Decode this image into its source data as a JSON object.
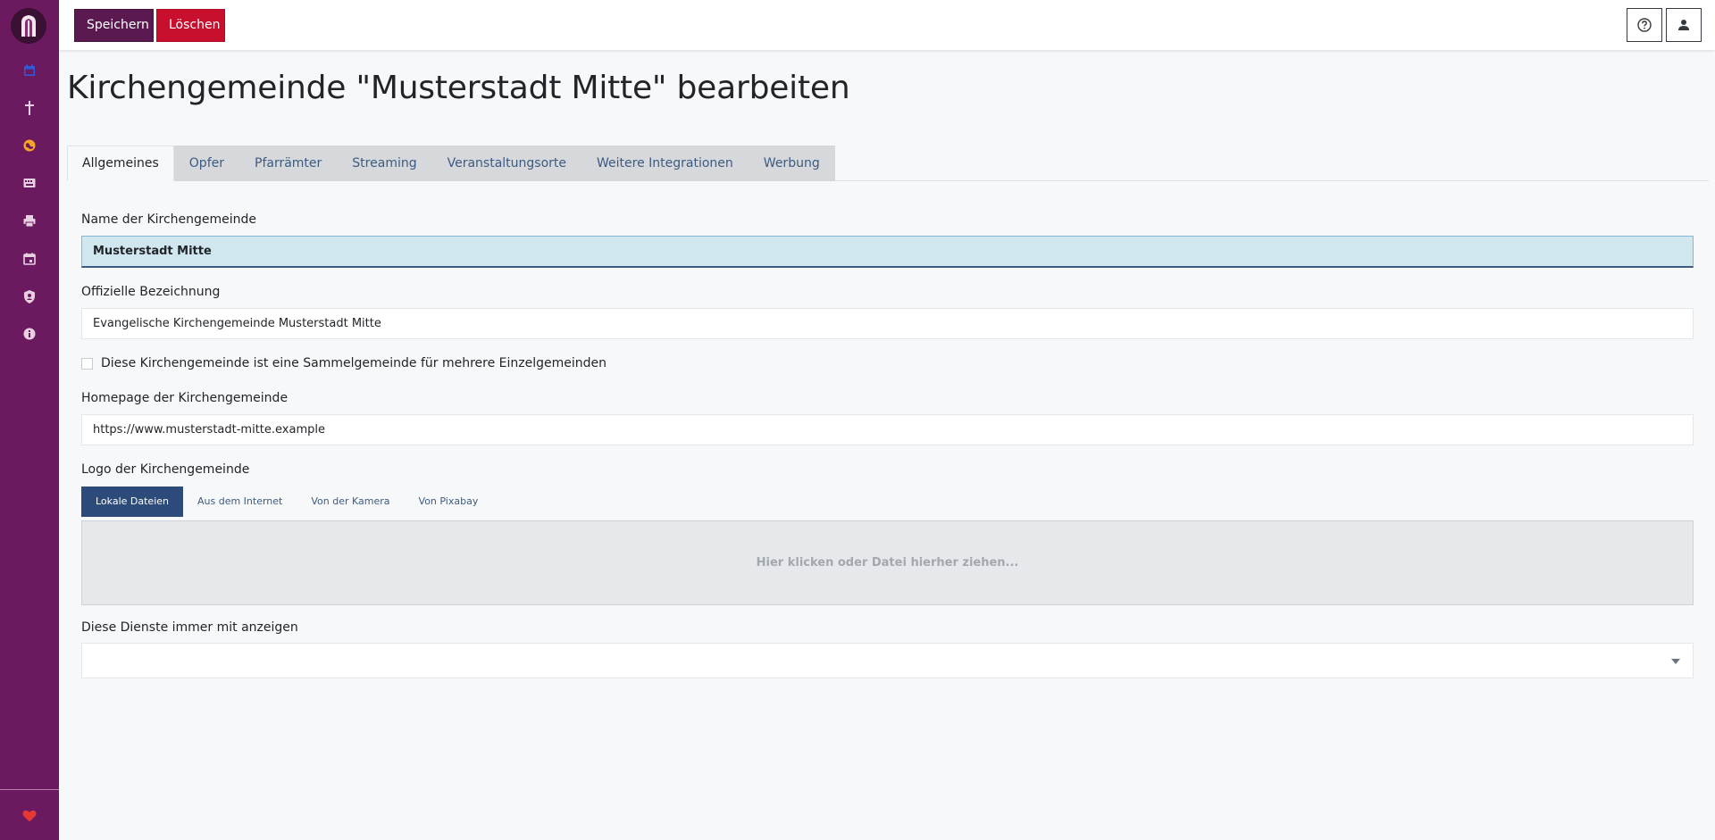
{
  "colors": {
    "sidebar": "#6b1a5f",
    "save_button": "#5a1a4f",
    "delete_button": "#c8102e",
    "tab_link": "#3d5a80",
    "logo_tab_active": "#2c4a7a"
  },
  "sidebar": {
    "items": [
      {
        "icon": "calendar-icon"
      },
      {
        "icon": "cross-icon"
      },
      {
        "icon": "globe-icon"
      },
      {
        "icon": "keyboard-icon"
      },
      {
        "icon": "printer-icon"
      },
      {
        "icon": "calendar-event-icon"
      },
      {
        "icon": "user-shield-icon"
      },
      {
        "icon": "info-icon"
      }
    ],
    "footer_icon": "heart-icon"
  },
  "toolbar": {
    "save_label": "Speichern",
    "delete_label": "Löschen",
    "help_icon": "help-icon",
    "user_icon": "user-icon"
  },
  "page": {
    "title": "Kirchengemeinde \"Musterstadt Mitte\" bearbeiten"
  },
  "tabs": [
    {
      "label": "Allgemeines",
      "active": true
    },
    {
      "label": "Opfer"
    },
    {
      "label": "Pfarrämter"
    },
    {
      "label": "Streaming"
    },
    {
      "label": "Veranstaltungsorte"
    },
    {
      "label": "Weitere Integrationen"
    },
    {
      "label": "Werbung"
    }
  ],
  "form": {
    "name": {
      "label": "Name der Kirchengemeinde",
      "value": "Musterstadt Mitte"
    },
    "official": {
      "label": "Offizielle Bezeichnung",
      "value": "Evangelische Kirchengemeinde Musterstadt Mitte"
    },
    "collective": {
      "label": "Diese Kirchengemeinde ist eine Sammelgemeinde für mehrere Einzelgemeinden",
      "checked": false
    },
    "homepage": {
      "label": "Homepage der Kirchengemeinde",
      "value": "https://www.musterstadt-mitte.example"
    },
    "logo": {
      "label": "Logo der Kirchengemeinde",
      "tabs": [
        "Lokale Dateien",
        "Aus dem Internet",
        "Von der Kamera",
        "Von Pixabay"
      ],
      "dropzone_text": "Hier klicken oder Datei hierher ziehen..."
    },
    "services": {
      "label": "Diese Dienste immer mit anzeigen",
      "value": ""
    }
  }
}
